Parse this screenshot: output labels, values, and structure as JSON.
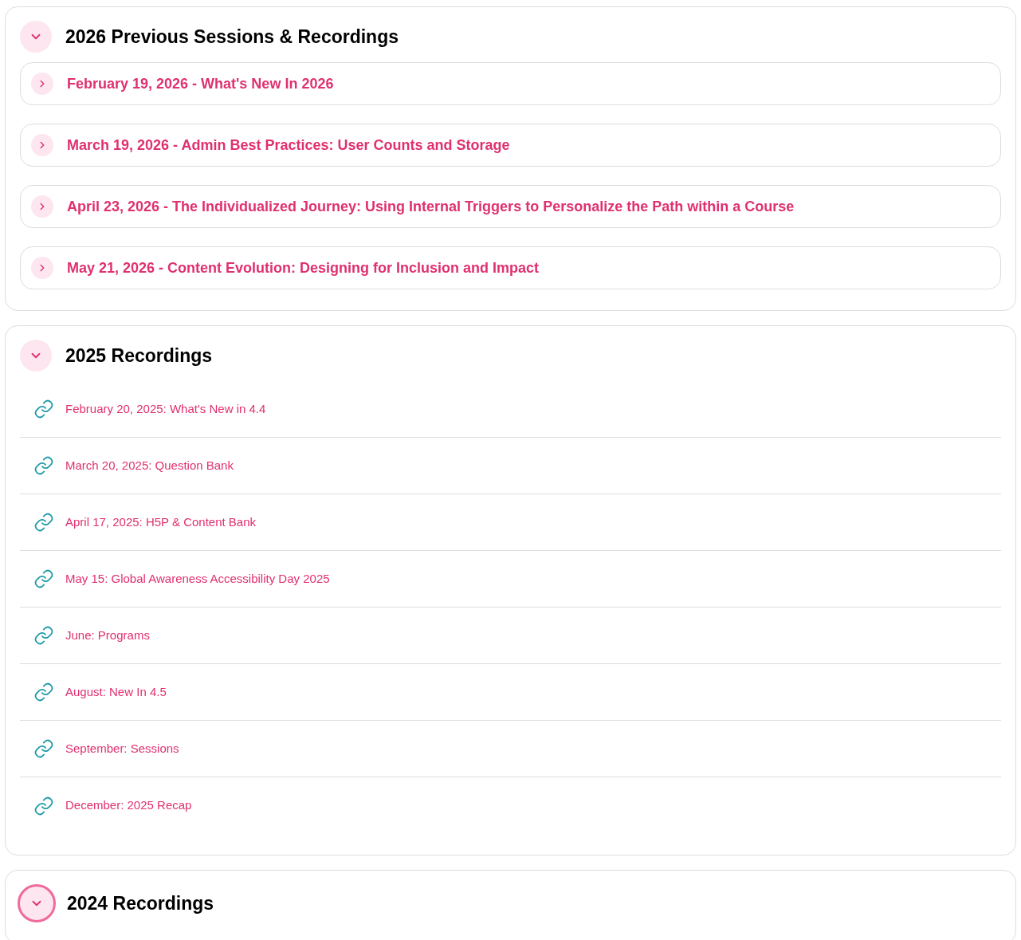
{
  "sections": [
    {
      "title": "2026 Previous Sessions & Recordings",
      "expanded": true,
      "focused": false,
      "kind": "sessions",
      "items": [
        {
          "label": "February 19, 2026 - What's New In 2026",
          "expanded": false
        },
        {
          "label": "March 19, 2026 - Admin Best Practices: User Counts and Storage",
          "expanded": false
        },
        {
          "label": "April 23, 2026 - The Individualized Journey: Using Internal Triggers to Personalize the Path within a Course",
          "expanded": false
        },
        {
          "label": "May 21, 2026 - Content Evolution: Designing for Inclusion and Impact",
          "expanded": false
        }
      ]
    },
    {
      "title": "2025 Recordings",
      "expanded": true,
      "focused": false,
      "kind": "links",
      "items": [
        {
          "label": "February 20, 2025: What's New in 4.4"
        },
        {
          "label": "March 20, 2025: Question Bank"
        },
        {
          "label": "April 17, 2025: H5P & Content Bank"
        },
        {
          "label": "May 15: Global Awareness Accessibility Day 2025"
        },
        {
          "label": "June: Programs"
        },
        {
          "label": "August: New In 4.5"
        },
        {
          "label": "September: Sessions"
        },
        {
          "label": "December: 2025 Recap"
        }
      ]
    },
    {
      "title": "2024 Recordings",
      "expanded": true,
      "focused": true,
      "kind": "links"
    }
  ]
}
